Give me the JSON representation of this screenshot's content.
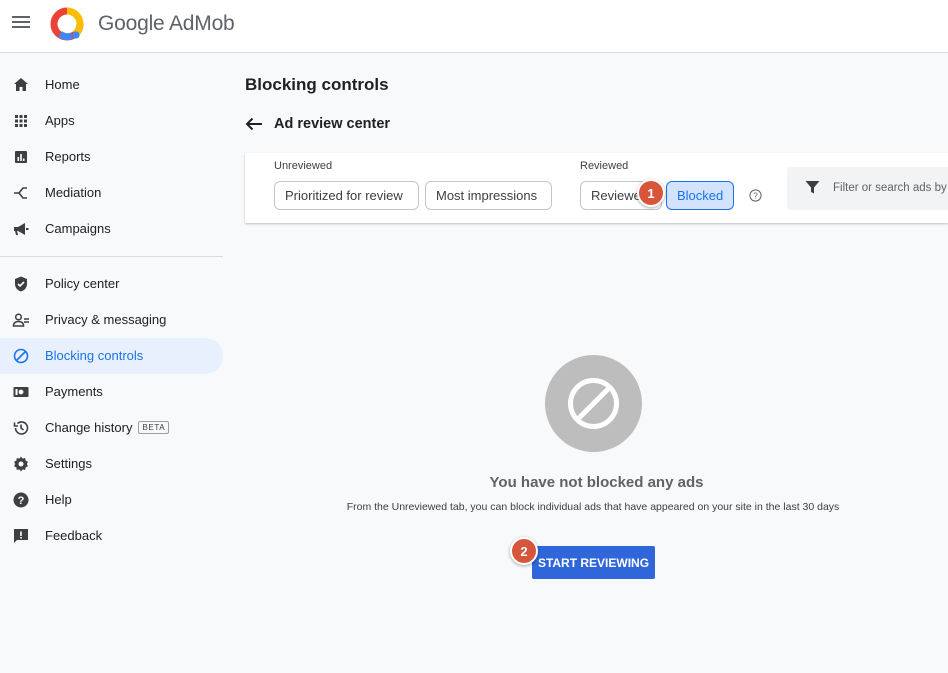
{
  "header": {
    "brand": "Google AdMob"
  },
  "sidebar": {
    "items": [
      {
        "label": "Home",
        "icon": "home-icon"
      },
      {
        "label": "Apps",
        "icon": "apps-grid-icon"
      },
      {
        "label": "Reports",
        "icon": "reports-icon"
      },
      {
        "label": "Mediation",
        "icon": "mediation-icon"
      },
      {
        "label": "Campaigns",
        "icon": "megaphone-icon"
      },
      {
        "label": "Policy center",
        "icon": "shield-icon"
      },
      {
        "label": "Privacy & messaging",
        "icon": "privacy-icon"
      },
      {
        "label": "Blocking controls",
        "icon": "block-icon",
        "active": true
      },
      {
        "label": "Payments",
        "icon": "payments-icon"
      },
      {
        "label": "Change history",
        "icon": "history-icon",
        "badge": "BETA"
      },
      {
        "label": "Settings",
        "icon": "gear-icon"
      },
      {
        "label": "Help",
        "icon": "help-icon"
      },
      {
        "label": "Feedback",
        "icon": "feedback-icon"
      }
    ]
  },
  "main": {
    "title": "Blocking controls",
    "subtitle": "Ad review center",
    "tabs": {
      "unreviewed_label": "Unreviewed",
      "reviewed_label": "Reviewed",
      "unreviewed": [
        "Prioritized for review",
        "Most impressions"
      ],
      "reviewed": [
        "Reviewed",
        "Blocked"
      ],
      "selected": "Blocked"
    },
    "filter": {
      "placeholder": "Filter or search ads by"
    },
    "empty_state": {
      "title": "You have not blocked any ads",
      "description": "From the Unreviewed tab, you can block individual ads that have appeared on your site in the last 30 days",
      "cta": "START REVIEWING"
    }
  },
  "markers": [
    "1",
    "2"
  ],
  "colors": {
    "accent": "#1a73e8",
    "cta": "#2f66d9",
    "marker": "#d7553a",
    "active_bg": "#e8f0fe"
  }
}
